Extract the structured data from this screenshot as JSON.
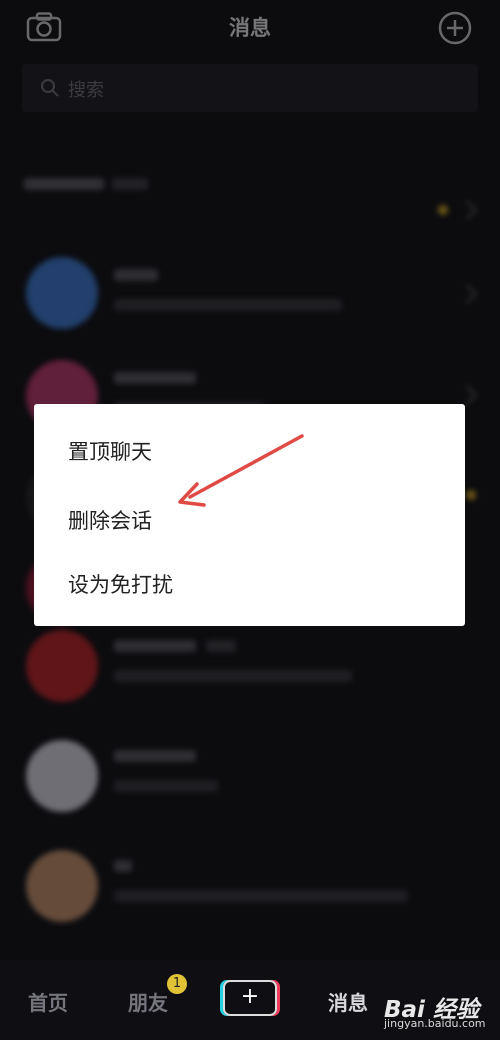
{
  "header": {
    "title": "消息",
    "camera_icon": "camera-icon",
    "add_icon": "plus-circle-icon"
  },
  "search": {
    "placeholder": "搜索",
    "icon": "search-icon"
  },
  "context_menu": {
    "items": [
      "置顶聊天",
      "删除会话",
      "设为免打扰"
    ]
  },
  "bottom_nav": {
    "tabs": [
      "首页",
      "朋友",
      "消息"
    ],
    "friends_badge": "1",
    "publish_label": "+"
  },
  "watermark": {
    "brand": "Bai 经验",
    "url": "jingyan.baidu.com"
  },
  "colors": {
    "accent_dot": "#c9a227",
    "arrow": "#e04a45",
    "badge": "#e2c235"
  }
}
